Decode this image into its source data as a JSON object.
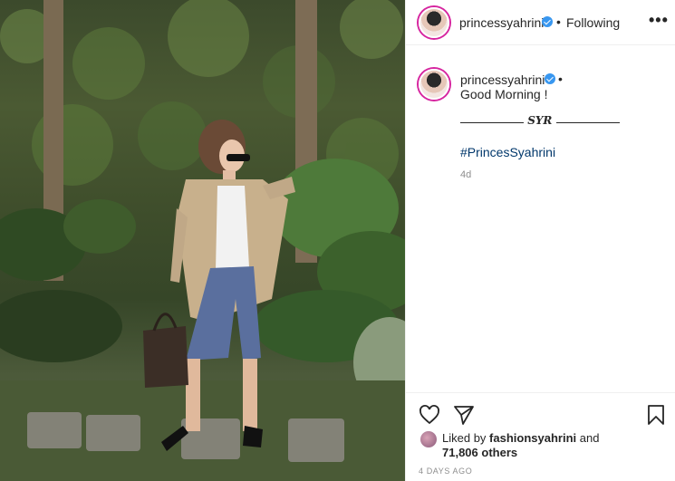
{
  "post": {
    "username": "princessyahrini",
    "follow_status": "Following",
    "separator": "•",
    "more_label": "•••"
  },
  "caption": {
    "username": "princessyahrini",
    "line1": "Good Morning !",
    "signature": "SYR",
    "hashtag": "#PrincesSyahrini",
    "age": "4d"
  },
  "likes": {
    "prefix": "Liked by",
    "user": "fashionsyahrini",
    "and": "and",
    "count": "71,806 others"
  },
  "timestamp": "4 DAYS AGO",
  "colors": {
    "verified": "#3897f0",
    "hashtag": "#00376b",
    "muted": "#8e8e8e",
    "story_ring": "#d6249f"
  },
  "icons": [
    "heart-icon",
    "send-icon",
    "bookmark-icon",
    "verified-badge-icon",
    "more-options-icon"
  ]
}
